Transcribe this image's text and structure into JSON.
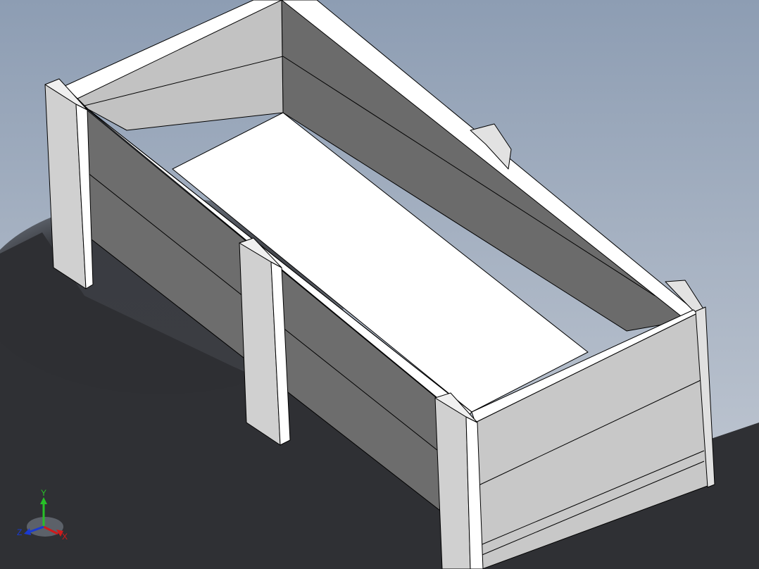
{
  "viewport": {
    "background_top": "#9aa9bd",
    "background_bottom": "#c3cad4",
    "shadow_color": "#2f3033"
  },
  "model": {
    "name": "wooden-crate",
    "colors": {
      "face_light": "#d9d9d9",
      "face_mid": "#c0c0c0",
      "face_dark": "#6a6a6a",
      "floor": "#ffffff",
      "edge": "#000000"
    }
  },
  "triad": {
    "x_label": "X",
    "y_label": "Y",
    "z_label": "Z",
    "x_color": "#d11a1a",
    "y_color": "#27c027",
    "z_color": "#1a3ad1"
  }
}
